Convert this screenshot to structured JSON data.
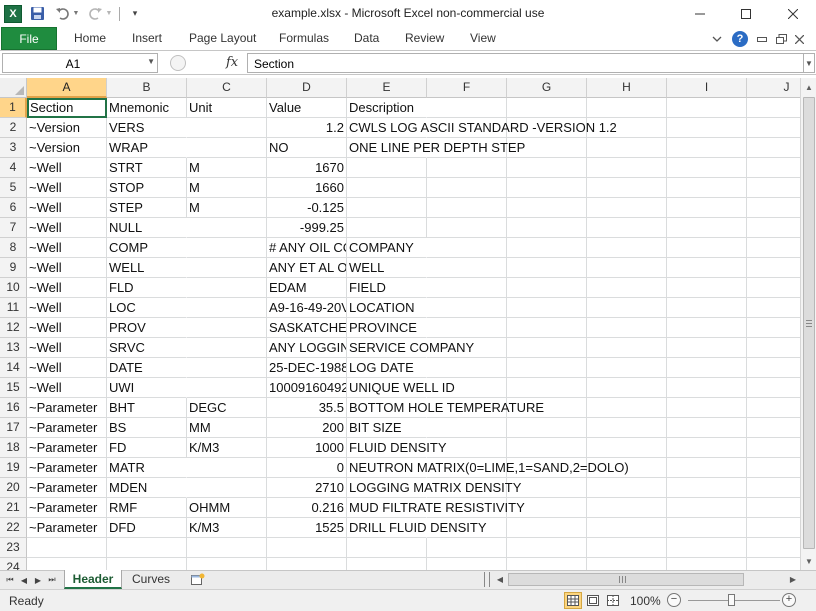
{
  "window": {
    "title": "example.xlsx  -  Microsoft Excel non-commercial use"
  },
  "quick_access": {
    "logo_letter": "X",
    "icons": [
      "excel-logo-icon",
      "save-icon",
      "undo-icon",
      "redo-icon",
      "customize-qat-icon"
    ]
  },
  "ribbon": {
    "file_label": "File",
    "tabs": [
      "Home",
      "Insert",
      "Page Layout",
      "Formulas",
      "Data",
      "Review",
      "View"
    ],
    "help_glyph": "?"
  },
  "formula_bar": {
    "name_box": "A1",
    "fx_label": "fx",
    "value": "Section"
  },
  "grid": {
    "columns": [
      "A",
      "B",
      "C",
      "D",
      "E",
      "F",
      "G",
      "H",
      "I",
      "J"
    ],
    "rows": [
      [
        "Section",
        "Mnemonic",
        "Unit",
        "Value",
        "Description"
      ],
      [
        "~Version",
        "VERS",
        "",
        "1.2",
        "CWLS LOG ASCII STANDARD -VERSION 1.2"
      ],
      [
        "~Version",
        "WRAP",
        "",
        "NO",
        "ONE LINE PER DEPTH STEP"
      ],
      [
        "~Well",
        "STRT",
        "M",
        "1670",
        ""
      ],
      [
        "~Well",
        "STOP",
        "M",
        "1660",
        ""
      ],
      [
        "~Well",
        "STEP",
        "M",
        "-0.125",
        ""
      ],
      [
        "~Well",
        "NULL",
        "",
        "-999.25",
        ""
      ],
      [
        "~Well",
        "COMP",
        "",
        "# ANY OIL CC",
        "COMPANY"
      ],
      [
        "~Well",
        "WELL",
        "",
        "ANY ET AL OI",
        "WELL"
      ],
      [
        "~Well",
        "FLD",
        "",
        "EDAM",
        "FIELD"
      ],
      [
        "~Well",
        "LOC",
        "",
        "A9-16-49-20V",
        "LOCATION"
      ],
      [
        "~Well",
        "PROV",
        "",
        "SASKATCHEV",
        "PROVINCE"
      ],
      [
        "~Well",
        "SRVC",
        "",
        "ANY LOGGIN",
        "SERVICE COMPANY"
      ],
      [
        "~Well",
        "DATE",
        "",
        "25-DEC-1988",
        "LOG DATE"
      ],
      [
        "~Well",
        "UWI",
        "",
        "10009160492",
        "UNIQUE WELL ID"
      ],
      [
        "~Parameter",
        "BHT",
        "DEGC",
        "35.5",
        "BOTTOM HOLE TEMPERATURE"
      ],
      [
        "~Parameter",
        "BS",
        "MM",
        "200",
        "BIT SIZE"
      ],
      [
        "~Parameter",
        "FD",
        "K/M3",
        "1000",
        "FLUID DENSITY"
      ],
      [
        "~Parameter",
        "MATR",
        "",
        "0",
        "NEUTRON MATRIX(0=LIME,1=SAND,2=DOLO)"
      ],
      [
        "~Parameter",
        "MDEN",
        "",
        "2710",
        "LOGGING MATRIX DENSITY"
      ],
      [
        "~Parameter",
        "RMF",
        "OHMM",
        "0.216",
        "MUD FILTRATE RESISTIVITY"
      ],
      [
        "~Parameter",
        "DFD",
        "K/M3",
        "1525",
        "DRILL FLUID DENSITY"
      ],
      [
        "",
        "",
        "",
        "",
        ""
      ],
      [
        "",
        "",
        "",
        "",
        ""
      ]
    ],
    "numeric_column": "D",
    "active_cell": "A1"
  },
  "sheets": {
    "tabs": [
      "Header",
      "Curves"
    ],
    "active": "Header"
  },
  "status_bar": {
    "status": "Ready",
    "zoom": "100%",
    "zoom_out": "−",
    "zoom_in": "+"
  },
  "colors": {
    "accent": "#217346",
    "file_tab": "#1f8c3f",
    "header_highlight": "#ffd58a"
  }
}
